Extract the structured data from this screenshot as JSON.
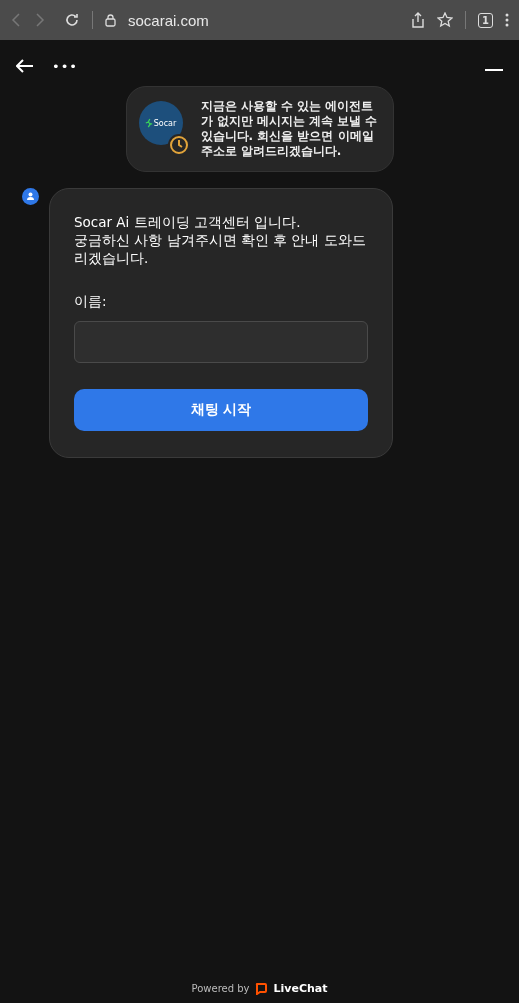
{
  "browser": {
    "url": "socarai.com",
    "tab_count": "1"
  },
  "header": {
    "more": "•••"
  },
  "notice": {
    "logo_text": "Socar",
    "text": "지금은 사용할 수 있는 에이전트가 없지만 메시지는 계속 보낼 수 있습니다. 회신을 받으면 이메일 주소로 알려드리겠습니다."
  },
  "message": {
    "lines": [
      "Socar Ai 트레이딩 고객센터 입니다.",
      "궁금하신 사항 남겨주시면 확인 후 안내 도와드리겠습니다."
    ],
    "form": {
      "label": "이름:",
      "button": "채팅 시작"
    }
  },
  "footer": {
    "powered": "Powered by",
    "brand": "LiveChat"
  }
}
